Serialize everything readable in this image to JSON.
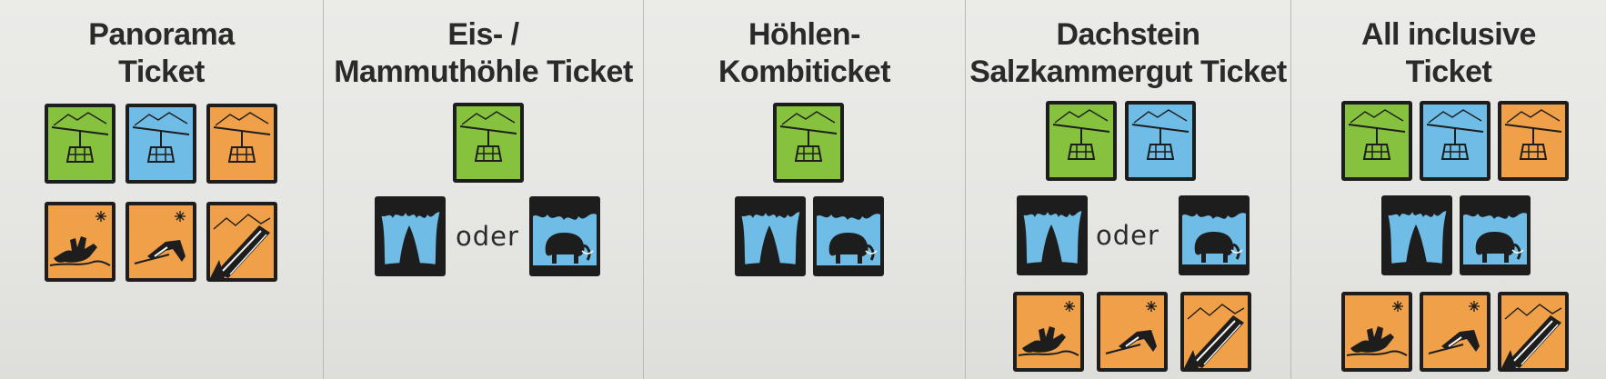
{
  "panels": [
    {
      "title_lines": [
        "Panorama",
        "Ticket"
      ],
      "rows": [
        [
          {
            "type": "gondola",
            "color": "green"
          },
          {
            "type": "gondola",
            "color": "blue"
          },
          {
            "type": "gondola",
            "color": "orange"
          }
        ],
        [
          {
            "type": "five-fingers",
            "color": "orange"
          },
          {
            "type": "welterbespirale",
            "color": "orange"
          },
          {
            "type": "skywalk",
            "color": "orange"
          }
        ]
      ]
    },
    {
      "title_lines": [
        "Eis- /",
        "Mammuthöhle Ticket"
      ],
      "rows": [
        [
          {
            "type": "gondola",
            "color": "green"
          }
        ],
        [
          {
            "type": "ice-cave",
            "color": "blue"
          },
          {
            "type": "separator",
            "text": "oder"
          },
          {
            "type": "mammoth-cave",
            "color": "blue"
          }
        ]
      ]
    },
    {
      "title_lines": [
        "Höhlen-",
        "Kombiticket"
      ],
      "rows": [
        [
          {
            "type": "gondola",
            "color": "green"
          }
        ],
        [
          {
            "type": "ice-cave",
            "color": "blue"
          },
          {
            "type": "mammoth-cave",
            "color": "blue"
          }
        ]
      ]
    },
    {
      "title_lines": [
        "Dachstein",
        "Salzkammergut Ticket"
      ],
      "rows": [
        [
          {
            "type": "gondola",
            "color": "green"
          },
          {
            "type": "gondola",
            "color": "blue"
          }
        ],
        [
          {
            "type": "ice-cave",
            "color": "blue"
          },
          {
            "type": "separator",
            "text": "oder"
          },
          {
            "type": "mammoth-cave",
            "color": "blue"
          }
        ],
        [
          {
            "type": "five-fingers",
            "color": "orange"
          },
          {
            "type": "welterbespirale",
            "color": "orange"
          },
          {
            "type": "skywalk",
            "color": "orange"
          }
        ]
      ]
    },
    {
      "title_lines": [
        "All inclusive",
        "Ticket"
      ],
      "rows": [
        [
          {
            "type": "gondola",
            "color": "green"
          },
          {
            "type": "gondola",
            "color": "blue"
          },
          {
            "type": "gondola",
            "color": "orange"
          }
        ],
        [
          {
            "type": "ice-cave",
            "color": "blue"
          },
          {
            "type": "mammoth-cave",
            "color": "blue"
          }
        ],
        [
          {
            "type": "five-fingers",
            "color": "orange"
          },
          {
            "type": "welterbespirale",
            "color": "orange"
          },
          {
            "type": "skywalk",
            "color": "orange"
          }
        ]
      ]
    }
  ],
  "colors": {
    "green": "#86c23d",
    "blue": "#6fbde6",
    "orange": "#f0a048",
    "outline": "#1d1d1d",
    "title": "#2a2a2a"
  }
}
